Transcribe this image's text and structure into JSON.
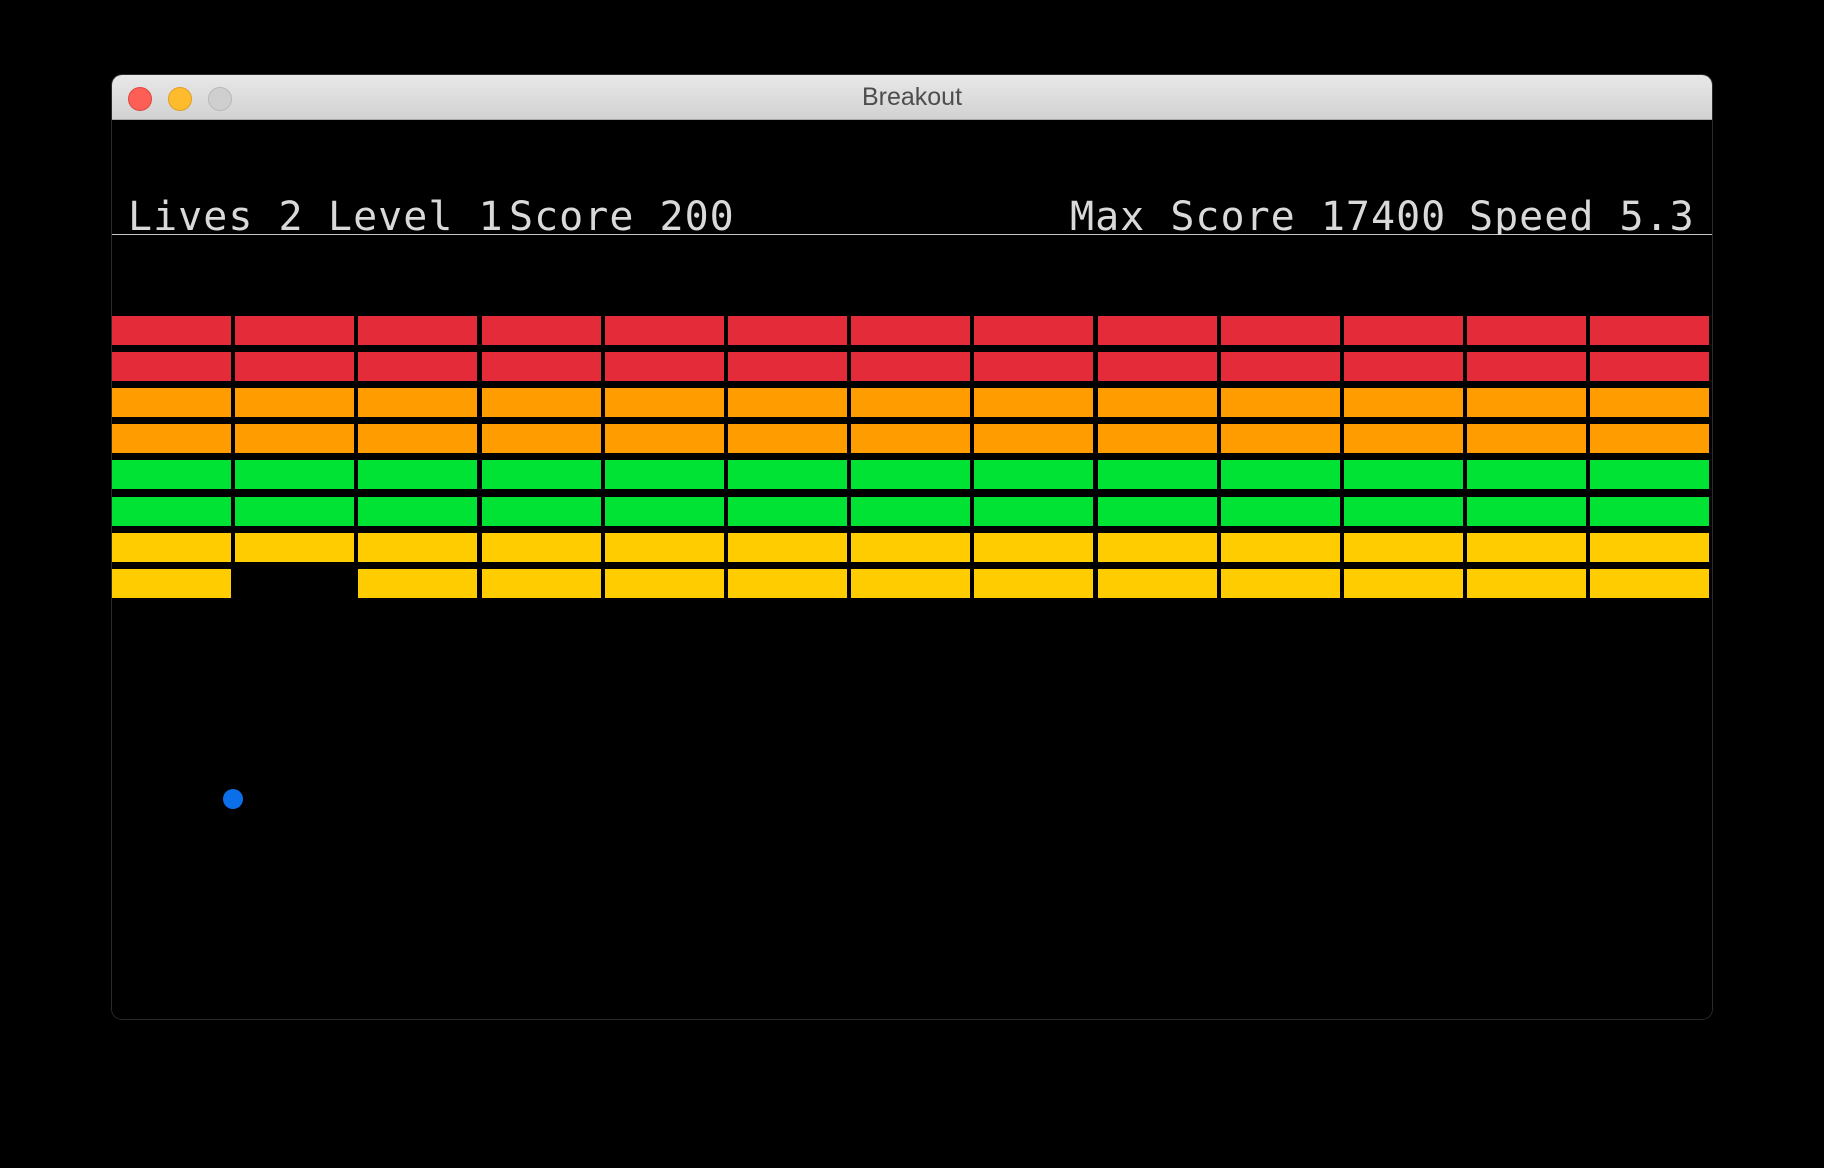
{
  "window": {
    "title": "Breakout"
  },
  "hud": {
    "lives": "Lives 2",
    "level": "Level 1",
    "score": "Score 200",
    "max_score": "Max Score 17400",
    "speed": "Speed 5.3"
  },
  "colors": {
    "red": "#e32b3a",
    "orange": "#ff9c00",
    "green": "#00e334",
    "yellow": "#ffcc00",
    "ball": "#0a6fe8",
    "paddle": "#c8c8c8"
  },
  "bricks": {
    "columns": 13,
    "rows": [
      {
        "color": "red",
        "present": [
          1,
          1,
          1,
          1,
          1,
          1,
          1,
          1,
          1,
          1,
          1,
          1,
          1
        ]
      },
      {
        "color": "red",
        "present": [
          1,
          1,
          1,
          1,
          1,
          1,
          1,
          1,
          1,
          1,
          1,
          1,
          1
        ]
      },
      {
        "color": "orange",
        "present": [
          1,
          1,
          1,
          1,
          1,
          1,
          1,
          1,
          1,
          1,
          1,
          1,
          1
        ]
      },
      {
        "color": "orange",
        "present": [
          1,
          1,
          1,
          1,
          1,
          1,
          1,
          1,
          1,
          1,
          1,
          1,
          1
        ]
      },
      {
        "color": "green",
        "present": [
          1,
          1,
          1,
          1,
          1,
          1,
          1,
          1,
          1,
          1,
          1,
          1,
          1
        ]
      },
      {
        "color": "green",
        "present": [
          1,
          1,
          1,
          1,
          1,
          1,
          1,
          1,
          1,
          1,
          1,
          1,
          1
        ]
      },
      {
        "color": "yellow",
        "present": [
          1,
          1,
          1,
          1,
          1,
          1,
          1,
          1,
          1,
          1,
          1,
          1,
          1
        ]
      },
      {
        "color": "yellow",
        "present": [
          1,
          0,
          1,
          1,
          1,
          1,
          1,
          1,
          1,
          1,
          1,
          1,
          1
        ]
      }
    ]
  }
}
